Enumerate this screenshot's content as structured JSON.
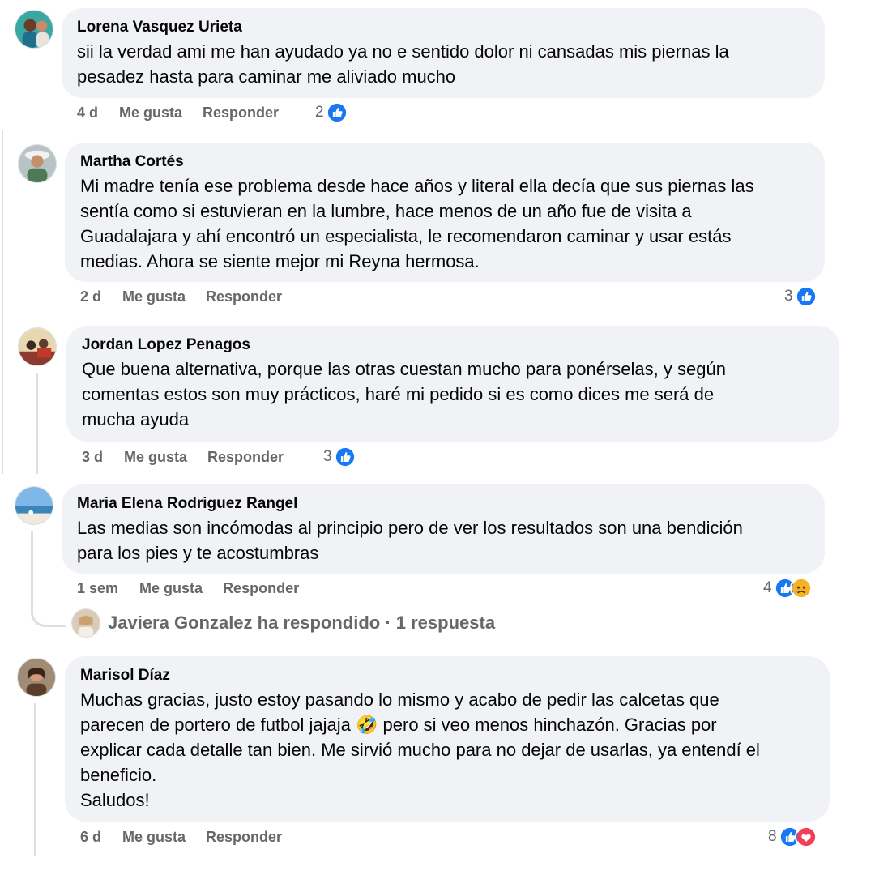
{
  "comments": [
    {
      "author": "Lorena Vasquez Urieta",
      "text": "sii la verdad ami me han ayudado ya no e sentido dolor ni cansadas mis piernas la\npesadez hasta para caminar me aliviado mucho",
      "time": "4 d",
      "like_label": "Me gusta",
      "reply_label": "Responder",
      "reaction_count": "2",
      "reactions": [
        "like-icon"
      ]
    },
    {
      "author": "Martha Cortés",
      "text": "Mi madre tenía ese problema desde hace años y literal ella decía que sus piernas las\nsentía como si estuvieran en la lumbre, hace menos de un año fue de visita a\nGuadalajara y ahí encontró un especialista, le recomendaron caminar y usar estás\nmedias. Ahora se siente mejor mi Reyna hermosa.",
      "time": "2 d",
      "like_label": "Me gusta",
      "reply_label": "Responder",
      "reaction_count": "3",
      "reactions": [
        "like-icon"
      ]
    },
    {
      "author": "Jordan Lopez Penagos",
      "text": "Que buena alternativa, porque las otras cuestan mucho para ponérselas, y según\ncomentas estos son muy prácticos, haré mi pedido si es como dices me será de\nmucha ayuda",
      "time": "3 d",
      "like_label": "Me gusta",
      "reply_label": "Responder",
      "reaction_count": "3",
      "reactions": [
        "like-icon"
      ]
    },
    {
      "author": "Maria Elena Rodriguez Rangel",
      "text": "Las medias son incómodas al principio pero de ver los resultados son una bendición\npara los pies y te acostumbras",
      "time": "1 sem",
      "like_label": "Me gusta",
      "reply_label": "Responder",
      "reaction_count": "4",
      "reactions": [
        "like-icon",
        "sad-icon"
      ],
      "reply_summary": "Javiera Gonzalez ha respondido · 1 respuesta"
    },
    {
      "author": "Marisol Díaz",
      "text": "Muchas gracias, justo estoy pasando lo mismo y acabo de pedir las calcetas que\nparecen de portero de futbol jajaja 🤣 pero si veo menos hinchazón. Gracias por\nexplicar cada detalle tan bien. Me sirvió mucho para no dejar de usarlas, ya entendí el\nbeneficio.\nSaludos!",
      "time": "6 d",
      "like_label": "Me gusta",
      "reply_label": "Responder",
      "reaction_count": "8",
      "reactions": [
        "like-icon",
        "love-icon"
      ]
    }
  ],
  "colors": {
    "bubble": "#f0f2f5",
    "like_blue": "#1877f2",
    "love_red": "#f33e58",
    "muted_text": "#65676b"
  }
}
